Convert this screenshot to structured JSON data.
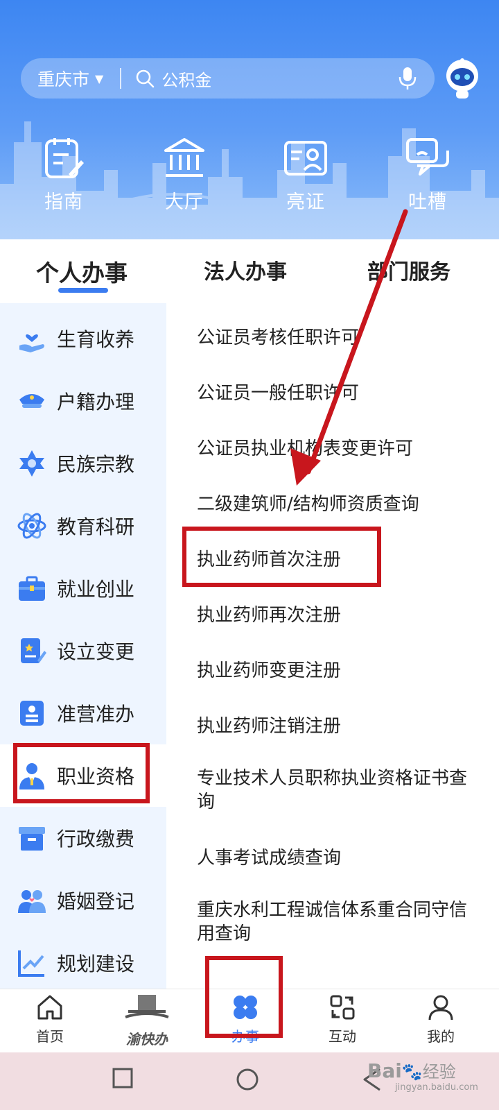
{
  "search": {
    "city": "重庆市",
    "placeholder": "公积金"
  },
  "quick_actions": [
    {
      "label": "指南",
      "icon": "guide-icon"
    },
    {
      "label": "大厅",
      "icon": "hall-icon"
    },
    {
      "label": "亮证",
      "icon": "id-card-icon"
    },
    {
      "label": "吐槽",
      "icon": "feedback-icon"
    }
  ],
  "tabs": {
    "personal": "个人办事",
    "legal": "法人办事",
    "department": "部门服务"
  },
  "sidebar": {
    "items": [
      {
        "label": "生育收养",
        "icon": "hand-heart-icon"
      },
      {
        "label": "户籍办理",
        "icon": "police-cap-icon"
      },
      {
        "label": "民族宗教",
        "icon": "star-icon"
      },
      {
        "label": "教育科研",
        "icon": "atom-icon"
      },
      {
        "label": "就业创业",
        "icon": "briefcase-icon"
      },
      {
        "label": "设立变更",
        "icon": "document-edit-icon"
      },
      {
        "label": "准营准办",
        "icon": "license-icon"
      },
      {
        "label": "职业资格",
        "icon": "professional-icon"
      },
      {
        "label": "行政缴费",
        "icon": "box-icon"
      },
      {
        "label": "婚姻登记",
        "icon": "couple-icon"
      },
      {
        "label": "规划建设",
        "icon": "chart-icon"
      }
    ],
    "active_index": 7
  },
  "services": [
    "公证员考核任职许可",
    "公证员一般任职许可",
    "公证员执业机构表变更许可",
    "二级建筑师/结构师资质查询",
    "执业药师首次注册",
    "执业药师再次注册",
    "执业药师变更注册",
    "执业药师注销注册",
    "专业技术人员职称执业资格证书查询",
    "人事考试成绩查询",
    "重庆水利工程诚信体系重合同守信用查询"
  ],
  "bottom_nav": [
    {
      "label": "首页",
      "icon": "home-icon"
    },
    {
      "label": "渝快办",
      "icon": "logo-icon"
    },
    {
      "label": "办事",
      "icon": "clover-icon"
    },
    {
      "label": "互动",
      "icon": "exchange-icon"
    },
    {
      "label": "我的",
      "icon": "user-icon"
    }
  ],
  "watermark": {
    "brand": "Bai",
    "text": "经验",
    "url": "jingyan.baidu.com"
  },
  "colors": {
    "accent": "#3b7cf0",
    "header": "#4f93f4",
    "sidebar_bg": "#eef5ff",
    "highlight": "#c8161d"
  }
}
